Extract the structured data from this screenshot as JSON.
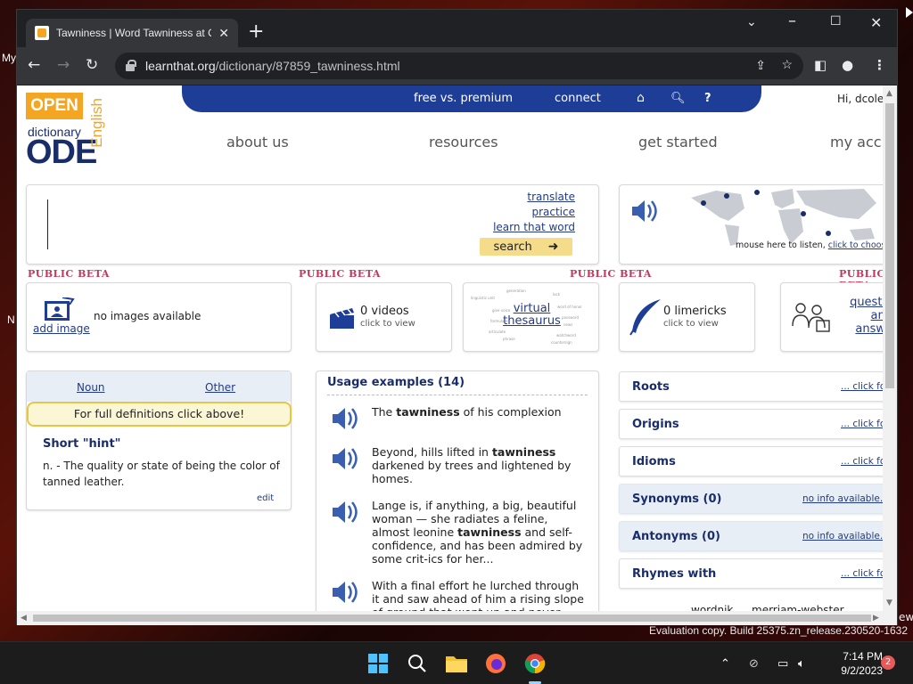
{
  "desktop": {
    "left_label_1": "My",
    "left_label_2": "N",
    "right_label": "ew",
    "evaluation_line1": "Evaluation copy. Build 25375.zn_release.230520-1632"
  },
  "browser": {
    "tab_title": "Tawniness | Word Tawniness at O",
    "url_domain": "learnthat.org",
    "url_path": "/dictionary/87859_tawniness.html"
  },
  "site": {
    "logo_open": "OPEN",
    "logo_dictionary": "dictionary",
    "logo_ode": "ODE",
    "logo_english": "English",
    "topbar": {
      "free_vs_premium": "free vs. premium",
      "connect": "connect"
    },
    "greeting": "Hi, dcolew",
    "nav": {
      "about": "about us",
      "resources": "resources",
      "get_started": "get started",
      "account": "my acc"
    },
    "search_links": {
      "translate": "translate",
      "practice": "practice",
      "learn": "learn that word"
    },
    "search_button": "search",
    "map_caption": "mouse here to listen,",
    "map_link": "click to choose/add",
    "beta": "PUBLIC BETA",
    "images": {
      "add": "add image",
      "none": "no images available"
    },
    "videos": {
      "count": "0 videos",
      "sub": "click to view"
    },
    "thesaurus": {
      "line1": "virtual",
      "line2": "thesaurus"
    },
    "limericks": {
      "count": "0 limericks",
      "sub": "click to view"
    },
    "qa": {
      "l1": "questio",
      "l2": "and",
      "l3": "answe"
    },
    "def_tabs": {
      "noun": "Noun",
      "other": "Other"
    },
    "full_def": "For full definitions click above!",
    "hint_title": "Short \"hint\"",
    "hint_text": "n. - The quality or state of being the color of tanned leather.",
    "edit": "edit",
    "usage_title": "Usage examples (14)",
    "usage": [
      {
        "pre": "The ",
        "b": "tawniness",
        "post": " of his complexion"
      },
      {
        "pre": "Beyond, hills lifted in ",
        "b": "tawniness",
        "post": " darkened by trees and lightened by homes."
      },
      {
        "pre": "Lange is, if anything, a big, beautiful woman — she radiates a feline, almost leonine ",
        "b": "tawniness",
        "post": " and self-confidence, and has been admired by some crit-ics for her..."
      },
      {
        "pre": "With a final effort he lurched through it and saw ahead of him a rising slope of ground that went up and never",
        "b": "",
        "post": ""
      }
    ],
    "right_boxes": [
      {
        "title": "Roots",
        "link": "... click fo"
      },
      {
        "title": "Origins",
        "link": "... click fo"
      },
      {
        "title": "Idioms",
        "link": "... click fo"
      },
      {
        "title": "Synonyms (0)",
        "link": "no info available..."
      },
      {
        "title": "Antonyms (0)",
        "link": "no info available..."
      },
      {
        "title": "Rhymes with",
        "link": "... click fo"
      }
    ],
    "bottom_links": {
      "wordnik": "wordnik",
      "mw": "merriam-webster"
    }
  },
  "taskbar": {
    "time": "7:14 PM",
    "date": "9/2/2023",
    "notifications": "2"
  }
}
